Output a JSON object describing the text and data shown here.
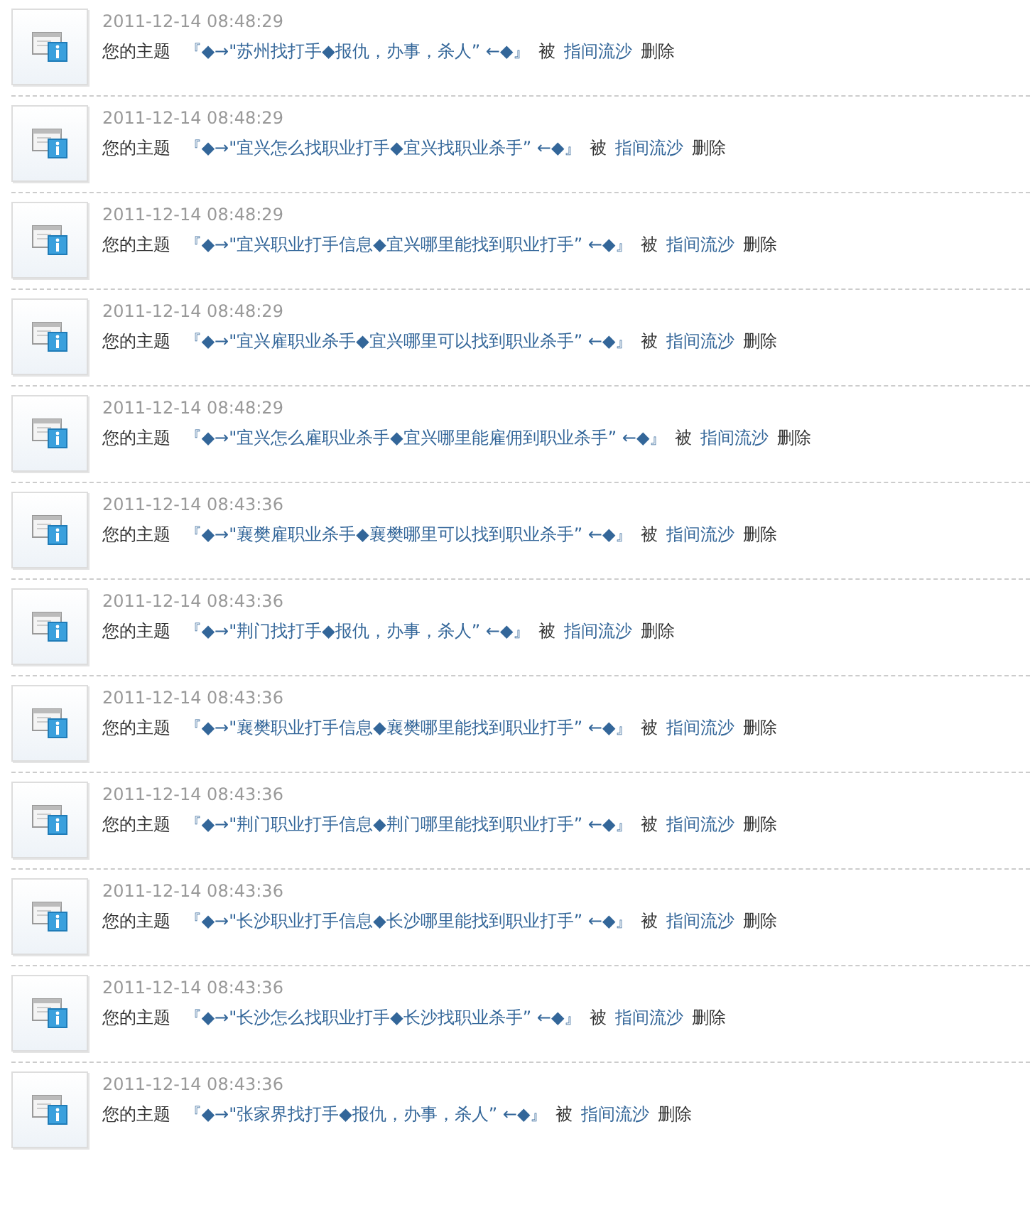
{
  "notices": [
    {
      "time": "2011-12-14 08:48:29",
      "prefix": "您的主题",
      "title": "『◆→\"苏州找打手◆报仇，办事，杀人” ←◆』",
      "by": "被",
      "user": "指间流沙",
      "action": "删除"
    },
    {
      "time": "2011-12-14 08:48:29",
      "prefix": "您的主题",
      "title": "『◆→\"宜兴怎么找职业打手◆宜兴找职业杀手” ←◆』",
      "by": "被",
      "user": "指间流沙",
      "action": "删除"
    },
    {
      "time": "2011-12-14 08:48:29",
      "prefix": "您的主题",
      "title": "『◆→\"宜兴职业打手信息◆宜兴哪里能找到职业打手” ←◆』",
      "by": "被",
      "user": "指间流沙",
      "action": "删除"
    },
    {
      "time": "2011-12-14 08:48:29",
      "prefix": "您的主题",
      "title": "『◆→\"宜兴雇职业杀手◆宜兴哪里可以找到职业杀手” ←◆』",
      "by": "被",
      "user": "指间流沙",
      "action": "删除"
    },
    {
      "time": "2011-12-14 08:48:29",
      "prefix": "您的主题",
      "title": "『◆→\"宜兴怎么雇职业杀手◆宜兴哪里能雇佣到职业杀手” ←◆』",
      "by": "被",
      "user": "指间流沙",
      "action": "删除"
    },
    {
      "time": "2011-12-14 08:43:36",
      "prefix": "您的主题",
      "title": "『◆→\"襄樊雇职业杀手◆襄樊哪里可以找到职业杀手” ←◆』",
      "by": "被",
      "user": "指间流沙",
      "action": "删除"
    },
    {
      "time": "2011-12-14 08:43:36",
      "prefix": "您的主题",
      "title": "『◆→\"荆门找打手◆报仇，办事，杀人” ←◆』",
      "by": "被",
      "user": "指间流沙",
      "action": "删除"
    },
    {
      "time": "2011-12-14 08:43:36",
      "prefix": "您的主题",
      "title": "『◆→\"襄樊职业打手信息◆襄樊哪里能找到职业打手” ←◆』",
      "by": "被",
      "user": "指间流沙",
      "action": "删除"
    },
    {
      "time": "2011-12-14 08:43:36",
      "prefix": "您的主题",
      "title": "『◆→\"荆门职业打手信息◆荆门哪里能找到职业打手” ←◆』",
      "by": "被",
      "user": "指间流沙",
      "action": "删除"
    },
    {
      "time": "2011-12-14 08:43:36",
      "prefix": "您的主题",
      "title": "『◆→\"长沙职业打手信息◆长沙哪里能找到职业打手” ←◆』",
      "by": "被",
      "user": "指间流沙",
      "action": "删除"
    },
    {
      "time": "2011-12-14 08:43:36",
      "prefix": "您的主题",
      "title": "『◆→\"长沙怎么找职业打手◆长沙找职业杀手” ←◆』",
      "by": "被",
      "user": "指间流沙",
      "action": "删除"
    },
    {
      "time": "2011-12-14 08:43:36",
      "prefix": "您的主题",
      "title": "『◆→\"张家界找打手◆报仇，办事，杀人” ←◆』",
      "by": "被",
      "user": "指间流沙",
      "action": "删除"
    }
  ]
}
